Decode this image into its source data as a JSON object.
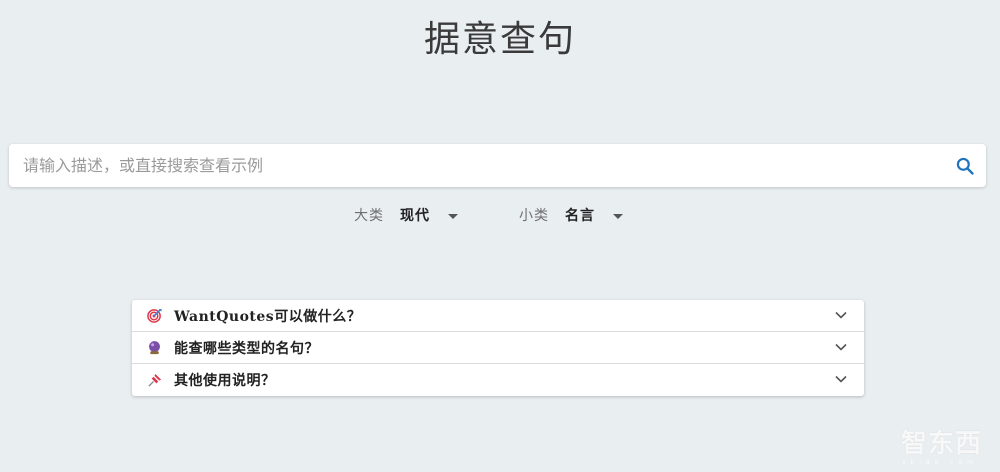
{
  "app": {
    "title": "据意查句"
  },
  "search": {
    "placeholder": "请输入描述，或直接搜索查看示例",
    "value": "",
    "icon": "search-icon"
  },
  "filters": {
    "main": {
      "label": "大类",
      "value": "现代"
    },
    "sub": {
      "label": "小类",
      "value": "名言"
    }
  },
  "faq": [
    {
      "icon": "target-icon",
      "question": "WantQuotes可以做什么？"
    },
    {
      "icon": "crystal-ball-icon",
      "question": "能查哪些类型的名句？"
    },
    {
      "icon": "pushpin-icon",
      "question": "其他使用说明？"
    }
  ],
  "colors": {
    "background": "#e9eef1",
    "accent": "#1e73be",
    "card": "#ffffff"
  },
  "watermark": {
    "text": "智东西",
    "sub": "zhidx.com"
  }
}
